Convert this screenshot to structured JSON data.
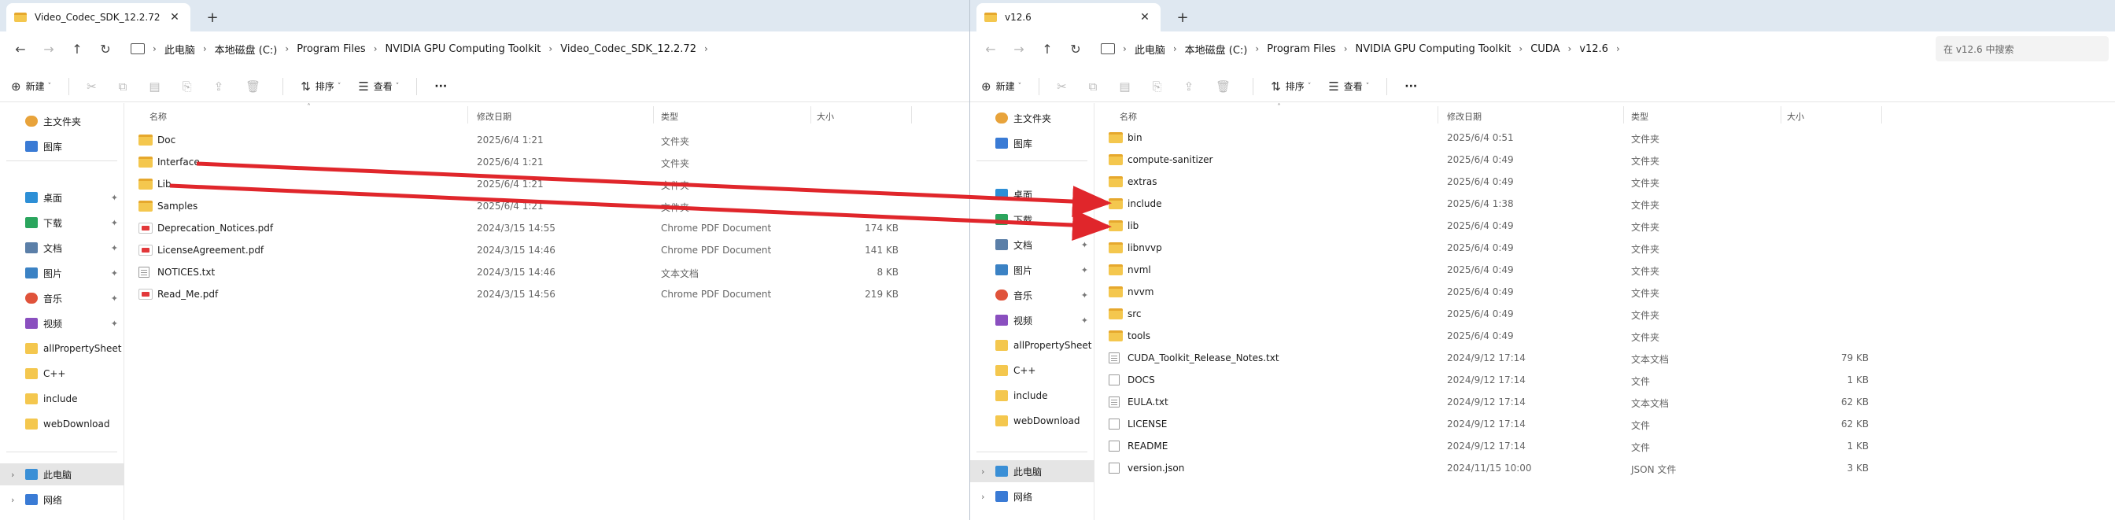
{
  "left": {
    "tab_title": "Video_Codec_SDK_12.2.72",
    "path": [
      "此电脑",
      "本地磁盘 (C:)",
      "Program Files",
      "NVIDIA GPU Computing Toolkit",
      "Video_Codec_SDK_12.2.72"
    ],
    "commands": {
      "new": "新建",
      "sort": "排序",
      "view": "查看",
      "more": "···"
    },
    "headers": {
      "name": "名称",
      "date": "修改日期",
      "type": "类型",
      "size": "大小"
    },
    "sidebar": [
      {
        "label": "主文件夹",
        "icon": "home-icon"
      },
      {
        "label": "图库",
        "icon": "gallery-icon"
      },
      {
        "label": "桌面",
        "icon": "desktop-icon",
        "pinned": true
      },
      {
        "label": "下载",
        "icon": "download-icon",
        "pinned": true
      },
      {
        "label": "文档",
        "icon": "document-icon",
        "pinned": true
      },
      {
        "label": "图片",
        "icon": "pictures-icon",
        "pinned": true
      },
      {
        "label": "音乐",
        "icon": "music-icon",
        "pinned": true
      },
      {
        "label": "视频",
        "icon": "video-icon",
        "pinned": true
      },
      {
        "label": "allPropertySheet",
        "icon": "folder-icon"
      },
      {
        "label": "C++",
        "icon": "folder-icon"
      },
      {
        "label": "include",
        "icon": "folder-icon"
      },
      {
        "label": "webDownload",
        "icon": "folder-icon"
      },
      {
        "label": "此电脑",
        "icon": "pc-icon",
        "selected": true
      },
      {
        "label": "网络",
        "icon": "network-icon"
      }
    ],
    "files": [
      {
        "name": "Doc",
        "date": "2025/6/4 1:21",
        "type": "文件夹",
        "size": "",
        "kind": "folder"
      },
      {
        "name": "Interface",
        "date": "2025/6/4 1:21",
        "type": "文件夹",
        "size": "",
        "kind": "folder"
      },
      {
        "name": "Lib",
        "date": "2025/6/4 1:21",
        "type": "文件夹",
        "size": "",
        "kind": "folder"
      },
      {
        "name": "Samples",
        "date": "2025/6/4 1:21",
        "type": "文件夹",
        "size": "",
        "kind": "folder"
      },
      {
        "name": "Deprecation_Notices.pdf",
        "date": "2024/3/15 14:55",
        "type": "Chrome PDF Document",
        "size": "174 KB",
        "kind": "pdf"
      },
      {
        "name": "LicenseAgreement.pdf",
        "date": "2024/3/15 14:46",
        "type": "Chrome PDF Document",
        "size": "141 KB",
        "kind": "pdf"
      },
      {
        "name": "NOTICES.txt",
        "date": "2024/3/15 14:46",
        "type": "文本文档",
        "size": "8 KB",
        "kind": "doc"
      },
      {
        "name": "Read_Me.pdf",
        "date": "2024/3/15 14:56",
        "type": "Chrome PDF Document",
        "size": "219 KB",
        "kind": "pdf"
      }
    ]
  },
  "right": {
    "tab_title": "v12.6",
    "path": [
      "此电脑",
      "本地磁盘 (C:)",
      "Program Files",
      "NVIDIA GPU Computing Toolkit",
      "CUDA",
      "v12.6"
    ],
    "search_placeholder": "在 v12.6 中搜索",
    "commands": {
      "new": "新建",
      "sort": "排序",
      "view": "查看",
      "more": "···"
    },
    "headers": {
      "name": "名称",
      "date": "修改日期",
      "type": "类型",
      "size": "大小"
    },
    "sidebar": [
      {
        "label": "主文件夹",
        "icon": "home-icon"
      },
      {
        "label": "图库",
        "icon": "gallery-icon"
      },
      {
        "label": "桌面",
        "icon": "desktop-icon",
        "pinned": true
      },
      {
        "label": "下载",
        "icon": "download-icon",
        "pinned": true
      },
      {
        "label": "文档",
        "icon": "document-icon",
        "pinned": true
      },
      {
        "label": "图片",
        "icon": "pictures-icon",
        "pinned": true
      },
      {
        "label": "音乐",
        "icon": "music-icon",
        "pinned": true
      },
      {
        "label": "视频",
        "icon": "video-icon",
        "pinned": true
      },
      {
        "label": "allPropertySheet",
        "icon": "folder-icon"
      },
      {
        "label": "C++",
        "icon": "folder-icon"
      },
      {
        "label": "include",
        "icon": "folder-icon"
      },
      {
        "label": "webDownload",
        "icon": "folder-icon"
      },
      {
        "label": "此电脑",
        "icon": "pc-icon",
        "selected": true
      },
      {
        "label": "网络",
        "icon": "network-icon"
      }
    ],
    "files": [
      {
        "name": "bin",
        "date": "2025/6/4 0:51",
        "type": "文件夹",
        "size": "",
        "kind": "folder"
      },
      {
        "name": "compute-sanitizer",
        "date": "2025/6/4 0:49",
        "type": "文件夹",
        "size": "",
        "kind": "folder"
      },
      {
        "name": "extras",
        "date": "2025/6/4 0:49",
        "type": "文件夹",
        "size": "",
        "kind": "folder"
      },
      {
        "name": "include",
        "date": "2025/6/4 1:38",
        "type": "文件夹",
        "size": "",
        "kind": "folder"
      },
      {
        "name": "lib",
        "date": "2025/6/4 0:49",
        "type": "文件夹",
        "size": "",
        "kind": "folder"
      },
      {
        "name": "libnvvp",
        "date": "2025/6/4 0:49",
        "type": "文件夹",
        "size": "",
        "kind": "folder"
      },
      {
        "name": "nvml",
        "date": "2025/6/4 0:49",
        "type": "文件夹",
        "size": "",
        "kind": "folder"
      },
      {
        "name": "nvvm",
        "date": "2025/6/4 0:49",
        "type": "文件夹",
        "size": "",
        "kind": "folder"
      },
      {
        "name": "src",
        "date": "2025/6/4 0:49",
        "type": "文件夹",
        "size": "",
        "kind": "folder"
      },
      {
        "name": "tools",
        "date": "2025/6/4 0:49",
        "type": "文件夹",
        "size": "",
        "kind": "folder"
      },
      {
        "name": "CUDA_Toolkit_Release_Notes.txt",
        "date": "2024/9/12 17:14",
        "type": "文本文档",
        "size": "79 KB",
        "kind": "doc"
      },
      {
        "name": "DOCS",
        "date": "2024/9/12 17:14",
        "type": "文件",
        "size": "1 KB",
        "kind": "blank"
      },
      {
        "name": "EULA.txt",
        "date": "2024/9/12 17:14",
        "type": "文本文档",
        "size": "62 KB",
        "kind": "doc"
      },
      {
        "name": "LICENSE",
        "date": "2024/9/12 17:14",
        "type": "文件",
        "size": "62 KB",
        "kind": "blank"
      },
      {
        "name": "README",
        "date": "2024/9/12 17:14",
        "type": "文件",
        "size": "1 KB",
        "kind": "blank"
      },
      {
        "name": "version.json",
        "date": "2024/11/15 10:00",
        "type": "JSON 文件",
        "size": "3 KB",
        "kind": "blank"
      }
    ]
  },
  "arrows": [
    {
      "from": "Interface",
      "to": "include"
    },
    {
      "from": "Lib",
      "to": "lib"
    }
  ],
  "colors": {
    "arrow": "#e0262b",
    "folder": "#f4c74e",
    "tabbar": "#dfe8f1",
    "selection": "#e5e5e5"
  }
}
